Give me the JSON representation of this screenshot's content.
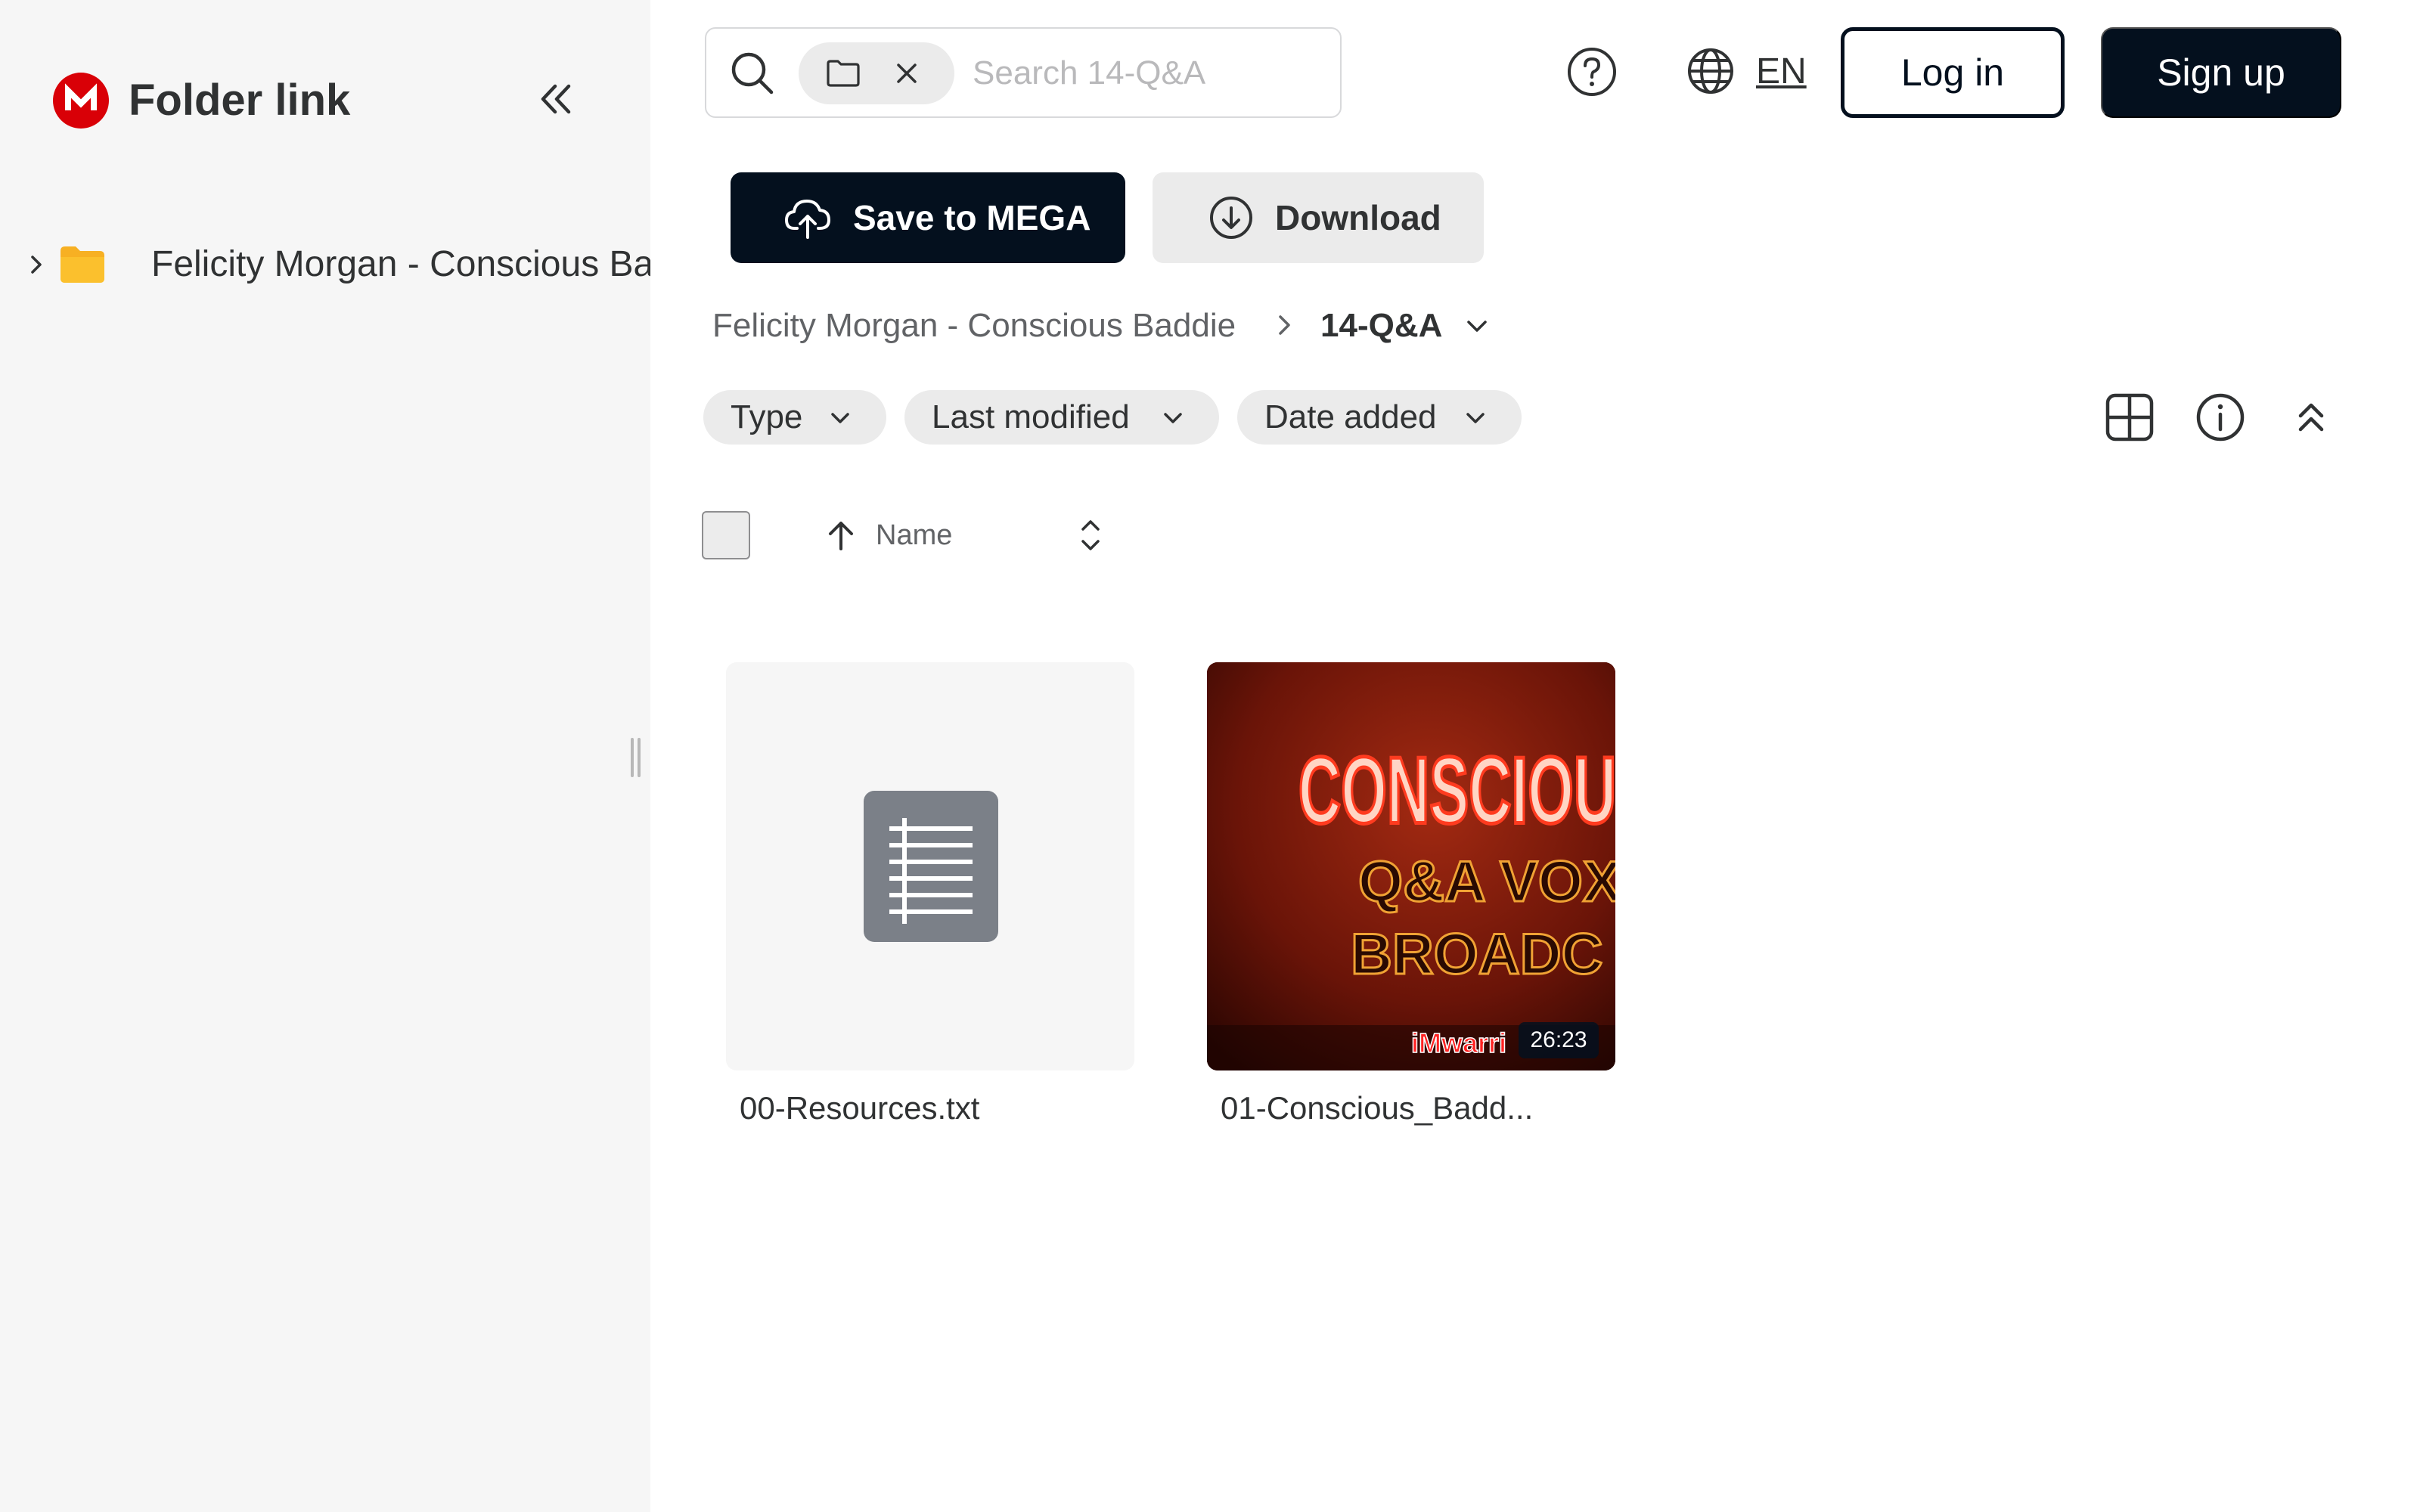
{
  "sidebar": {
    "app_title": "Folder link",
    "tree": [
      {
        "label": "Felicity Morgan - Conscious Baddie"
      }
    ]
  },
  "header": {
    "search": {
      "placeholder": "Search 14-Q&A",
      "value": ""
    },
    "language": "EN",
    "login_label": "Log in",
    "signup_label": "Sign up"
  },
  "actions": {
    "save_label": "Save to MEGA",
    "download_label": "Download"
  },
  "breadcrumb": {
    "parent": "Felicity Morgan - Conscious Baddie",
    "current": "14-Q&A"
  },
  "filters": [
    {
      "label": "Type"
    },
    {
      "label": "Last modified"
    },
    {
      "label": "Date added"
    }
  ],
  "sort": {
    "label": "Name",
    "direction": "ascending"
  },
  "files": [
    {
      "name": "00-Resources.txt",
      "kind": "text-file-icon"
    },
    {
      "name": "01-Conscious_Badd...",
      "kind": "video",
      "duration": "26:23",
      "thumbnail_text": [
        "CONSCIOUS B",
        "Q&A VOX",
        "BROADC",
        "iMwarri"
      ]
    }
  ],
  "colors": {
    "brand_red": "#d90007",
    "primary_dark": "#04101e",
    "sidebar_bg": "#f6f6f6",
    "folder_yellow": "#f7b023",
    "chip_bg": "#ebebeb"
  }
}
